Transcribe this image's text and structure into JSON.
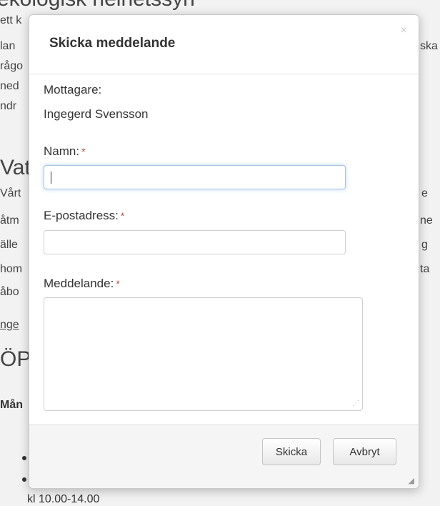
{
  "background": {
    "top_heading": "ekologisk helhetssyn",
    "left_lines": [
      "ett k",
      "lan",
      "rågo",
      "ned",
      "ndr"
    ],
    "right_top": "ska",
    "section_heading": "Vat",
    "left_lines2": [
      "Vårt",
      "åtm",
      "älle",
      "hom",
      "åbo"
    ],
    "right_lines2": [
      "e",
      "ne",
      "g",
      "ta"
    ],
    "link_fragment": "nge",
    "heading_fragment": "ÖP",
    "bold_fragment": "Mån",
    "bottom_text": "kl 10.00-14.00"
  },
  "modal": {
    "title": "Skicka meddelande",
    "close_symbol": "×",
    "recipient_label": "Mottagare:",
    "recipient_name": "Ingegerd Svensson",
    "name_label": "Namn:",
    "email_label": "E-postadress:",
    "message_label": "Meddelande:",
    "required_marker": "*",
    "name_value": "",
    "email_value": "",
    "message_value": "",
    "submit_label": "Skicka",
    "cancel_label": "Avbryt"
  }
}
